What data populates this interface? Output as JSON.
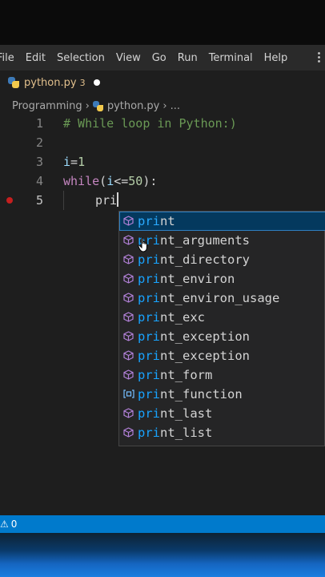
{
  "menubar": {
    "items": [
      "File",
      "Edit",
      "Selection",
      "View",
      "Go",
      "Run",
      "Terminal",
      "Help"
    ]
  },
  "tab": {
    "filename": "python.py",
    "problems": "3",
    "icon": "python-file-icon"
  },
  "breadcrumb": {
    "folder": "Programming",
    "file": "python.py",
    "ellipsis": "..."
  },
  "editor": {
    "line_numbers": [
      "1",
      "2",
      "3",
      "4",
      "5"
    ],
    "line1": "# While loop in Python:)",
    "line3_var": "i",
    "line3_op": "=",
    "line3_num": "1",
    "line4_kw": "while",
    "line4_open": "(",
    "line4_var": "i",
    "line4_op": "<=",
    "line4_num": "50",
    "line4_close": "):",
    "line5_text": "pri"
  },
  "suggestions": {
    "typed_prefix": "pri",
    "items": [
      {
        "match": "pri",
        "rest": "nt",
        "icon": "cube-icon"
      },
      {
        "match": "pri",
        "rest": "nt_arguments",
        "icon": "cube-icon"
      },
      {
        "match": "pri",
        "rest": "nt_directory",
        "icon": "cube-icon"
      },
      {
        "match": "pri",
        "rest": "nt_environ",
        "icon": "cube-icon"
      },
      {
        "match": "pri",
        "rest": "nt_environ_usage",
        "icon": "cube-icon"
      },
      {
        "match": "pri",
        "rest": "nt_exc",
        "icon": "cube-icon"
      },
      {
        "match": "pri",
        "rest": "nt_exception",
        "icon": "cube-icon"
      },
      {
        "match": "pri",
        "rest": "nt_exception",
        "icon": "cube-icon"
      },
      {
        "match": "pri",
        "rest": "nt_form",
        "icon": "cube-icon"
      },
      {
        "match": "pri",
        "rest": "nt_function",
        "icon": "variable-icon"
      },
      {
        "match": "pri",
        "rest": "nt_last",
        "icon": "cube-icon"
      },
      {
        "match": "pri",
        "rest": "nt_list",
        "icon": "cube-icon"
      }
    ]
  },
  "statusbar": {
    "warnings_icon": "warning-icon",
    "count": "0"
  },
  "colors": {
    "status_bar": "#007acc",
    "match_highlight": "#18a3ff",
    "modified_tab": "#e2c08d"
  }
}
